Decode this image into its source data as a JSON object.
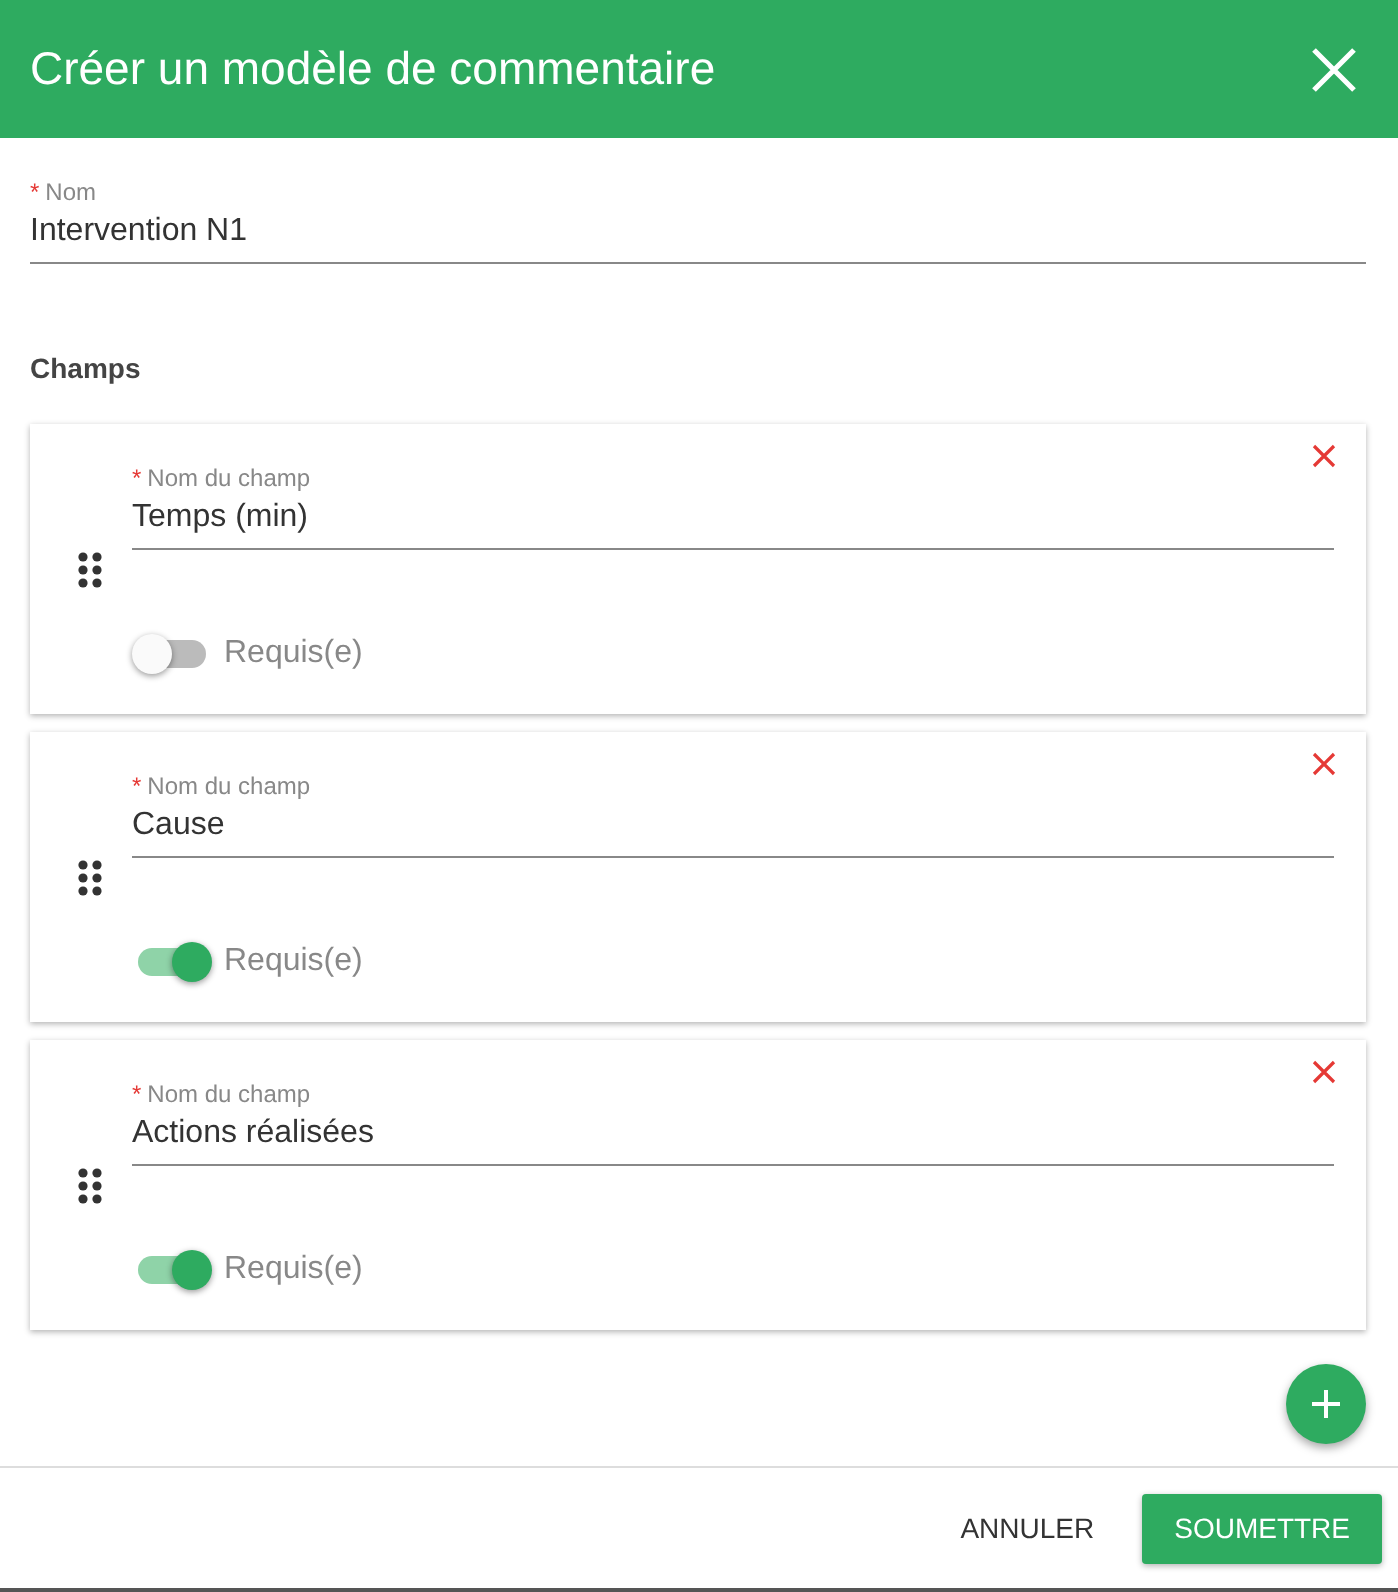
{
  "dialog": {
    "title": "Créer un modèle de commentaire"
  },
  "name_field": {
    "required_mark": "*",
    "label": "Nom",
    "value": "Intervention N1"
  },
  "section_title": "Champs",
  "fields": [
    {
      "required_mark": "*",
      "label": "Nom du champ",
      "value": "Temps (min)",
      "toggle_label": "Requis(e)",
      "on": false
    },
    {
      "required_mark": "*",
      "label": "Nom du champ",
      "value": "Cause",
      "toggle_label": "Requis(e)",
      "on": true
    },
    {
      "required_mark": "*",
      "label": "Nom du champ",
      "value": "Actions réalisées",
      "toggle_label": "Requis(e)",
      "on": true
    }
  ],
  "buttons": [
    {
      "label": "ANNULER",
      "kind": "text"
    },
    {
      "label": "SOUMETTRE",
      "kind": "primary"
    }
  ]
}
